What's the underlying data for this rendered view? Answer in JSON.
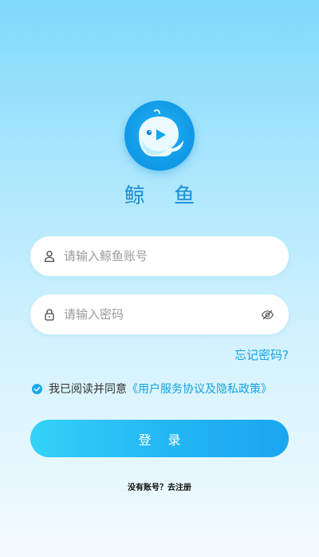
{
  "app": {
    "name": "鲸 鱼"
  },
  "logo": {
    "icon": "whale-logo-icon"
  },
  "account": {
    "placeholder": "请输入鲸鱼账号",
    "value": "",
    "icon": "user-icon"
  },
  "password": {
    "placeholder": "请输入密码",
    "value": "",
    "icon": "lock-icon",
    "toggle_icon": "eye-off-icon"
  },
  "forgot": {
    "label": "忘记密码?"
  },
  "agreement": {
    "checked": true,
    "text": "我已阅读并同意",
    "link": "《用户服务协议及隐私政策》"
  },
  "login": {
    "label": "登 录"
  },
  "register": {
    "label": "没有账号？去注册"
  },
  "colors": {
    "accent": "#14a3e6",
    "logo_bg": "#129be8",
    "button_start": "#34d2f8",
    "button_end": "#1aa5f0"
  }
}
